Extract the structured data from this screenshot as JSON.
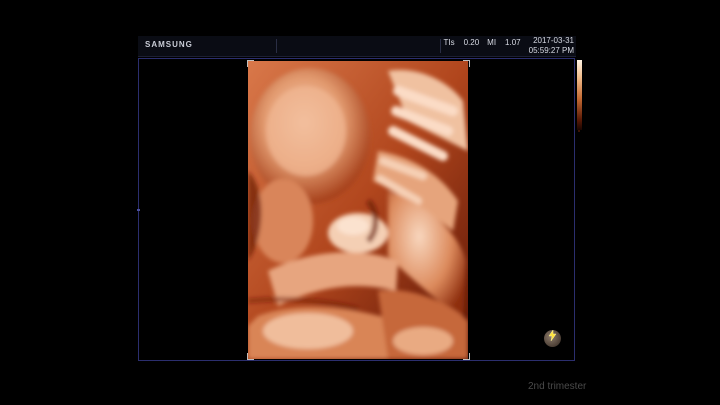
{
  "header": {
    "brand": "SAMSUNG",
    "readouts": [
      {
        "label": "TIs",
        "value": "0.20"
      },
      {
        "label": "MI",
        "value": "1.07"
      }
    ],
    "date": "2017-03-31",
    "time": "05:59:27 PM"
  },
  "viewport": {
    "image_subject": "3D fetal ultrasound render",
    "render_colors": {
      "highlight": "#f4c3a0",
      "mid": "#c65a30",
      "shadow": "#5b1205"
    }
  },
  "controls": {
    "light_icon": "light-source-icon"
  },
  "caption": "2nd trimester",
  "colors": {
    "background": "#000000",
    "frame_border": "#2b2e6e",
    "header_bg": "#0a0c14"
  }
}
